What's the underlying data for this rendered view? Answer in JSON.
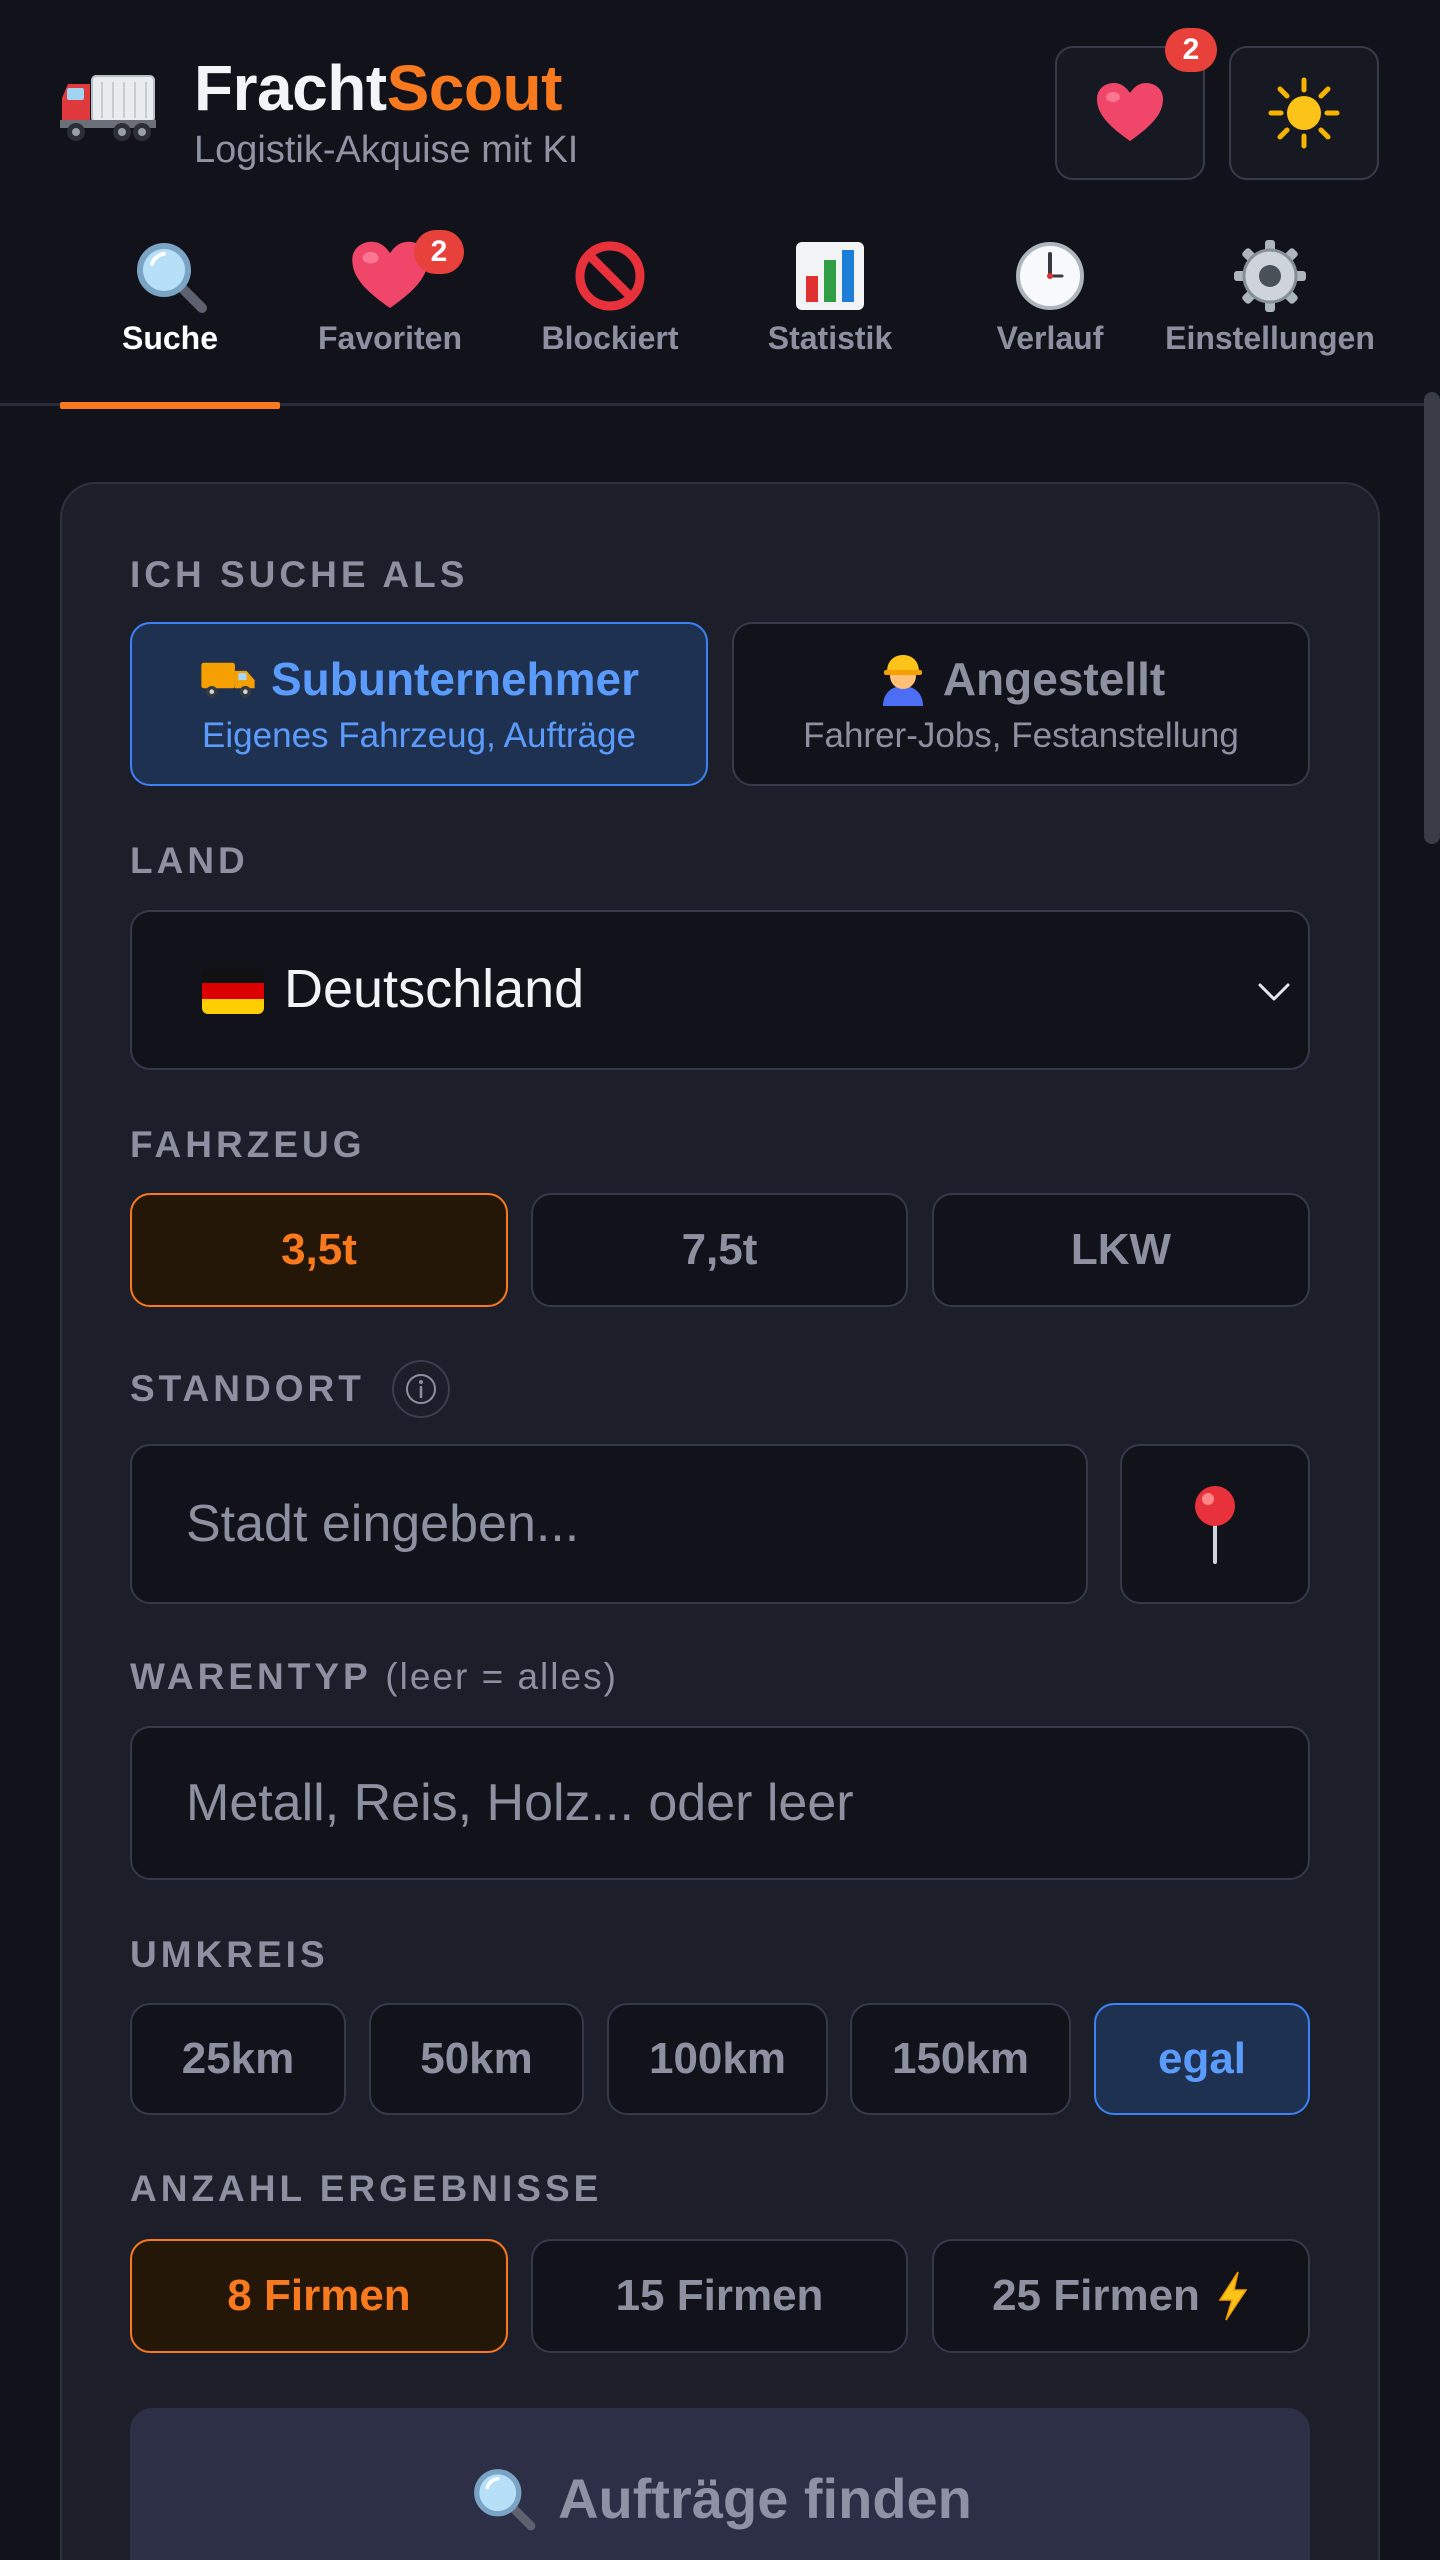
{
  "app": {
    "brand_part1": "Fracht",
    "brand_part2": "Scout",
    "tagline": "Logistik-Akquise mit KI",
    "favorites_badge": "2"
  },
  "nav": {
    "tabs": [
      {
        "label": "Suche",
        "icon": "magnifier-icon",
        "active": true
      },
      {
        "label": "Favoriten",
        "icon": "heart-icon",
        "badge": "2"
      },
      {
        "label": "Blockiert",
        "icon": "no-entry-icon"
      },
      {
        "label": "Statistik",
        "icon": "bar-chart-icon"
      },
      {
        "label": "Verlauf",
        "icon": "clock-icon"
      },
      {
        "label": "Einstellungen",
        "icon": "gear-icon"
      }
    ]
  },
  "form": {
    "role": {
      "label": "ICH SUCHE ALS",
      "options": [
        {
          "title": "Subunternehmer",
          "subtitle": "Eigenes Fahrzeug, Aufträge",
          "selected": true
        },
        {
          "title": "Angestellt",
          "subtitle": "Fahrer-Jobs, Festanstellung",
          "selected": false
        }
      ]
    },
    "country": {
      "label": "LAND",
      "value": "Deutschland"
    },
    "vehicle": {
      "label": "FAHRZEUG",
      "options": [
        "3,5t",
        "7,5t",
        "LKW"
      ],
      "selected": "3,5t"
    },
    "location": {
      "label": "STANDORT",
      "placeholder": "Stadt eingeben..."
    },
    "goods": {
      "label": "WARENTYP",
      "label_hint": "(leer = alles)",
      "placeholder": "Metall, Reis, Holz... oder leer"
    },
    "radius": {
      "label": "UMKREIS",
      "options": [
        "25km",
        "50km",
        "100km",
        "150km",
        "egal"
      ],
      "selected": "egal"
    },
    "count": {
      "label": "ANZAHL ERGEBNISSE",
      "options": [
        "8 Firmen",
        "15 Firmen",
        "25 Firmen"
      ],
      "selected": "8 Firmen"
    },
    "submit_label": "Aufträge finden"
  },
  "colors": {
    "accent_orange": "#f97a1e",
    "accent_blue": "#3b82f6",
    "badge_red": "#e8413b",
    "background": "#12131a",
    "card": "#1c1e29"
  }
}
